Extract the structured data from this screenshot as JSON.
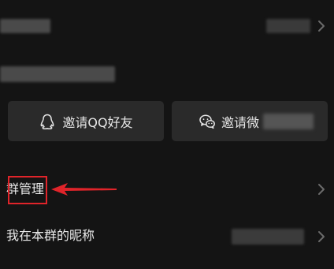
{
  "invite_buttons": {
    "qq_label": "邀请QQ好友",
    "wechat_label": "邀请微"
  },
  "menu": {
    "group_management": "群管理",
    "my_nickname": "我在本群的昵称"
  },
  "annotation": {
    "highlight_color": "#e0242a"
  },
  "icons": [
    "qq-penguin-icon",
    "wechat-icon",
    "chevron-right-icon"
  ]
}
